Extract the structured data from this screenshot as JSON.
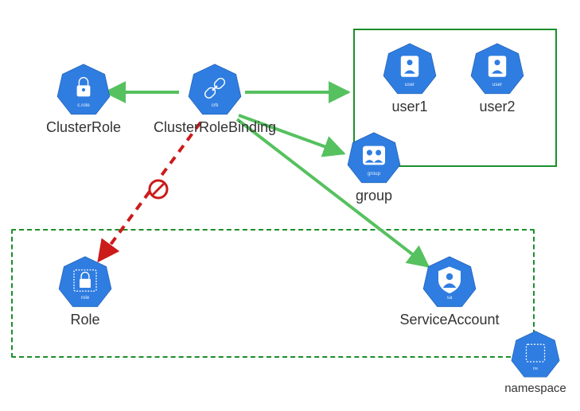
{
  "diagram": {
    "nodes": {
      "cluster_role": {
        "label": "ClusterRole",
        "icon": "lock-icon",
        "tag": "c.role"
      },
      "crb": {
        "label": "ClusterRoleBinding",
        "icon": "link-icon",
        "tag": "crb"
      },
      "user1": {
        "label": "user1",
        "icon": "user-icon",
        "tag": "user"
      },
      "user2": {
        "label": "user2",
        "icon": "user-icon",
        "tag": "user"
      },
      "group": {
        "label": "group",
        "icon": "group-icon",
        "tag": "group"
      },
      "role": {
        "label": "Role",
        "icon": "lock-icon",
        "tag": "role",
        "dashed": true
      },
      "sa": {
        "label": "ServiceAccount",
        "icon": "sa-icon",
        "tag": "sa"
      },
      "namespace": {
        "label": "namespace",
        "icon": "namespace-icon",
        "tag": "ns"
      }
    },
    "edges": [
      {
        "from": "crb",
        "to": "cluster_role",
        "style": "allowed"
      },
      {
        "from": "crb",
        "to": "user_group_box",
        "style": "allowed"
      },
      {
        "from": "crb",
        "to": "group",
        "style": "allowed"
      },
      {
        "from": "crb",
        "to": "sa",
        "style": "allowed"
      },
      {
        "from": "crb",
        "to": "role",
        "style": "denied"
      }
    ],
    "containers": {
      "user_group_box": {
        "type": "solid",
        "contains": [
          "user1",
          "user2",
          "group"
        ]
      },
      "namespace_box": {
        "type": "dashed",
        "contains": [
          "role",
          "sa"
        ]
      }
    },
    "colors": {
      "hept_fill": "#2f7de1",
      "hept_stroke": "#1f5fb0",
      "arrow_allowed": "#56c15f",
      "arrow_denied": "#cc1b1b",
      "box_border": "#1a8f2b"
    }
  }
}
